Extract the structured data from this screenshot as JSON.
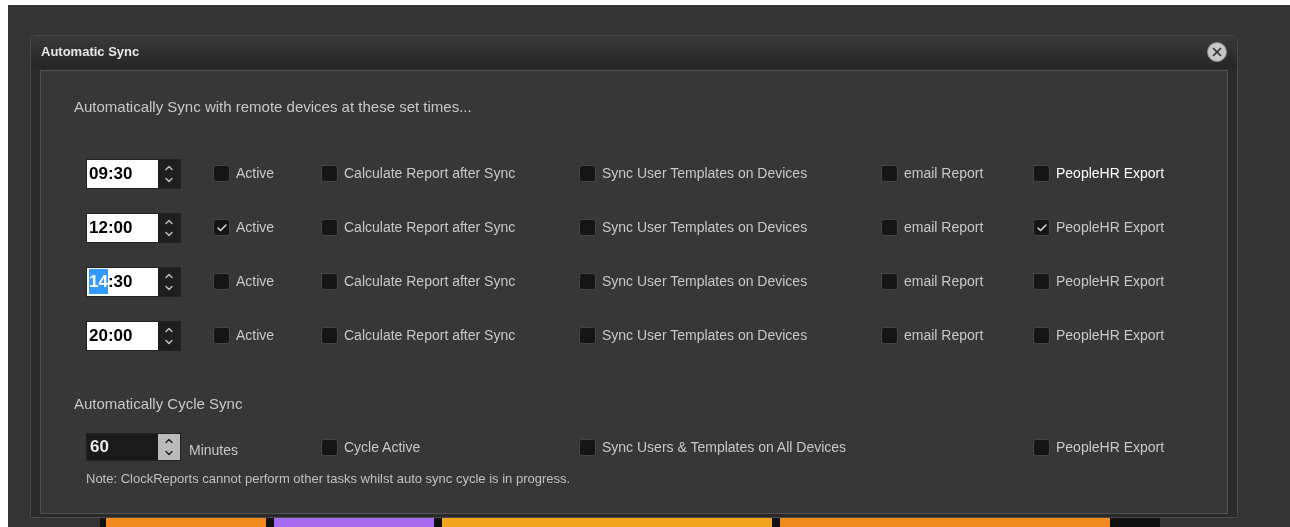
{
  "dialog": {
    "title": "Automatic Sync"
  },
  "schedule": {
    "heading": "Automatically Sync with remote devices at these set times...",
    "rows": [
      {
        "time": [
          {
            "text": "09:30",
            "selected": false
          }
        ],
        "options": [
          {
            "label": "Active",
            "checked": false,
            "focused": false
          },
          {
            "label": "Calculate Report after Sync",
            "checked": false,
            "focused": false
          },
          {
            "label": "Sync User Templates on Devices",
            "checked": false,
            "focused": false
          },
          {
            "label": "email Report",
            "checked": false,
            "focused": false
          },
          {
            "label": "PeopleHR Export",
            "checked": false,
            "focused": true
          }
        ]
      },
      {
        "time": [
          {
            "text": "12:00",
            "selected": false
          }
        ],
        "options": [
          {
            "label": "Active",
            "checked": true,
            "focused": false
          },
          {
            "label": "Calculate Report after Sync",
            "checked": false,
            "focused": false
          },
          {
            "label": "Sync User Templates on Devices",
            "checked": false,
            "focused": false
          },
          {
            "label": "email Report",
            "checked": false,
            "focused": false
          },
          {
            "label": "PeopleHR Export",
            "checked": true,
            "focused": false
          }
        ]
      },
      {
        "time": [
          {
            "text": "14",
            "selected": true
          },
          {
            "text": ":30",
            "selected": false
          }
        ],
        "options": [
          {
            "label": "Active",
            "checked": false,
            "focused": false
          },
          {
            "label": "Calculate Report after Sync",
            "checked": false,
            "focused": false
          },
          {
            "label": "Sync User Templates on Devices",
            "checked": false,
            "focused": false
          },
          {
            "label": "email Report",
            "checked": false,
            "focused": false
          },
          {
            "label": "PeopleHR Export",
            "checked": false,
            "focused": false
          }
        ]
      },
      {
        "time": [
          {
            "text": "20:00",
            "selected": false
          }
        ],
        "options": [
          {
            "label": "Active",
            "checked": false,
            "focused": false
          },
          {
            "label": "Calculate Report after Sync",
            "checked": false,
            "focused": false
          },
          {
            "label": "Sync User Templates on Devices",
            "checked": false,
            "focused": false
          },
          {
            "label": "email Report",
            "checked": false,
            "focused": false
          },
          {
            "label": "PeopleHR Export",
            "checked": false,
            "focused": false
          }
        ]
      }
    ]
  },
  "cycle": {
    "heading": "Automatically Cycle Sync",
    "interval": "60",
    "unit": "Minutes",
    "options": [
      {
        "label": "Cycle Active",
        "checked": false
      },
      {
        "label": "Sync Users & Templates on All Devices",
        "checked": false
      },
      {
        "label": "PeopleHR Export",
        "checked": false
      }
    ],
    "note": "Note: ClockReports cannot perform other tasks whilst auto sync cycle is in progress."
  }
}
